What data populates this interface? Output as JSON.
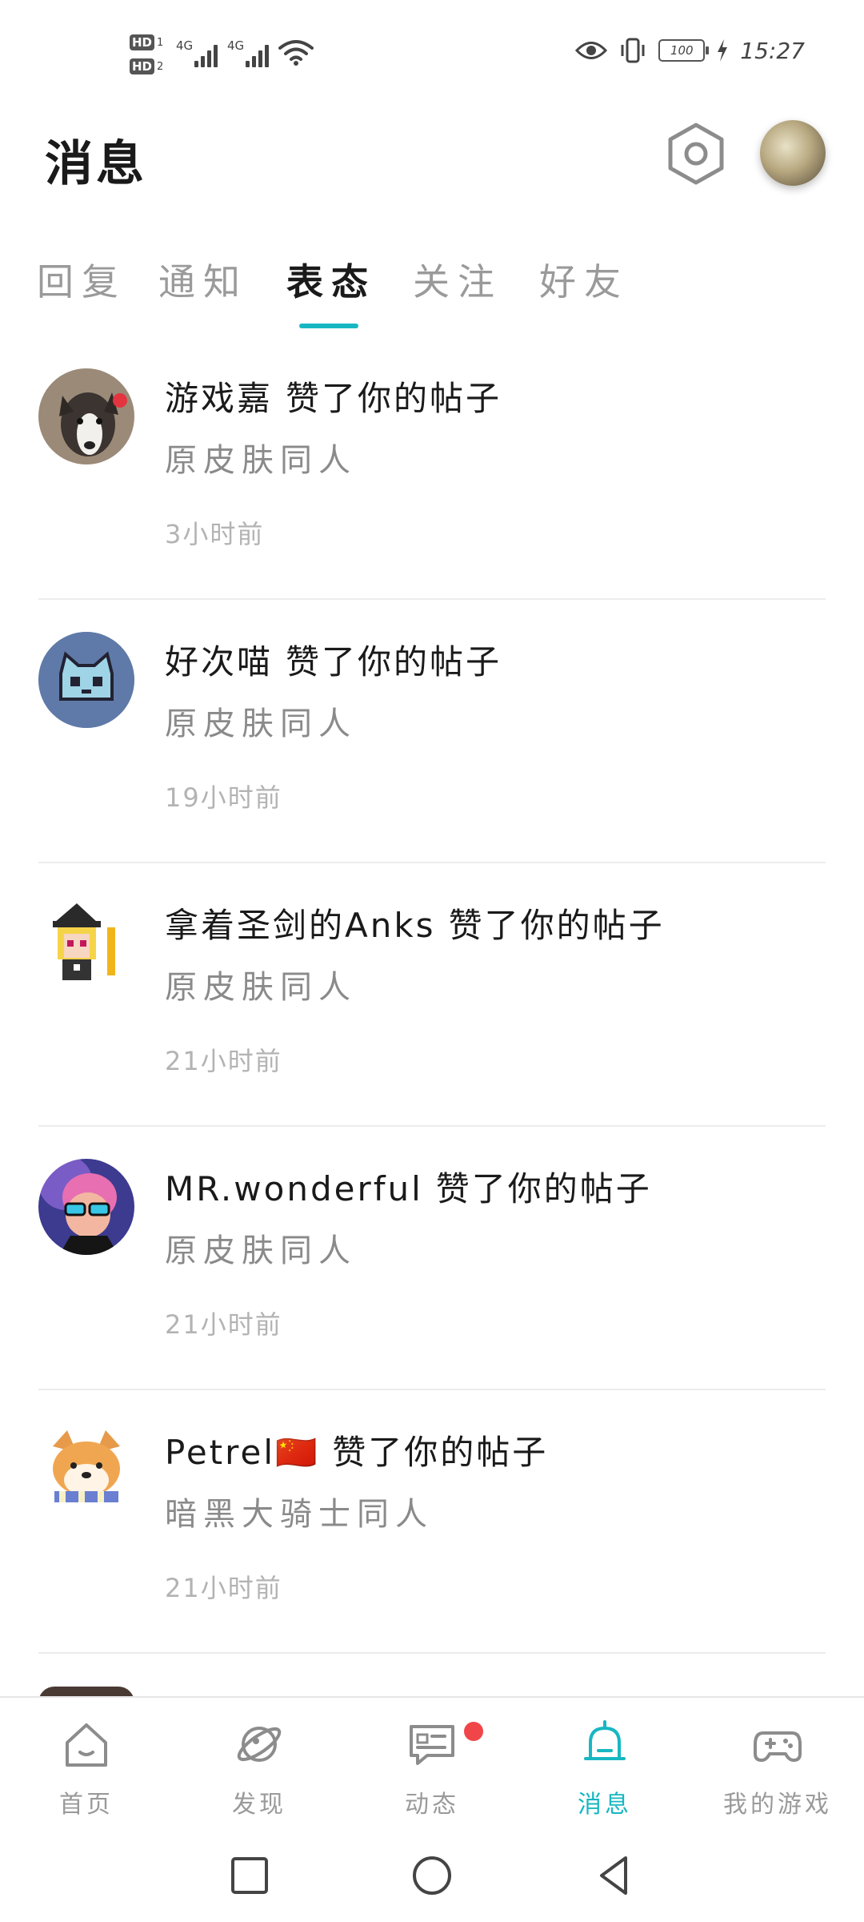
{
  "status_bar": {
    "hd1": "HD",
    "hd1_sub": "1",
    "hd2": "HD",
    "hd2_sub": "2",
    "signal1": "4G",
    "signal2": "4G",
    "battery": "100",
    "time": "15:27"
  },
  "header": {
    "title": "消息"
  },
  "tabs": [
    {
      "label": "回复"
    },
    {
      "label": "通知"
    },
    {
      "label": "表态"
    },
    {
      "label": "关注"
    },
    {
      "label": "好友"
    }
  ],
  "active_tab": "表态",
  "messages": [
    {
      "user": "游戏嘉",
      "action": "赞了你的帖子",
      "subtitle": "原皮肤同人",
      "time": "3小时前"
    },
    {
      "user": "好次喵",
      "action": "赞了你的帖子",
      "subtitle": "原皮肤同人",
      "time": "19小时前"
    },
    {
      "user": "拿着圣剑的Anks",
      "action": "赞了你的帖子",
      "subtitle": "原皮肤同人",
      "time": "21小时前"
    },
    {
      "user": "MR.wonderful",
      "action": "赞了你的帖子",
      "subtitle": "原皮肤同人",
      "time": "21小时前"
    },
    {
      "user": "Petrel🇨🇳",
      "action": "赞了你的帖子",
      "subtitle": "暗黑大骑士同人",
      "time": "21小时前"
    }
  ],
  "bottom_nav": [
    {
      "label": "首页",
      "icon": "home-icon"
    },
    {
      "label": "发现",
      "icon": "planet-icon"
    },
    {
      "label": "动态",
      "icon": "feed-icon"
    },
    {
      "label": "消息",
      "icon": "bell-icon"
    },
    {
      "label": "我的游戏",
      "icon": "gamepad-icon"
    }
  ],
  "colors": {
    "accent": "#17b7c2",
    "badge": "#f0464a"
  }
}
